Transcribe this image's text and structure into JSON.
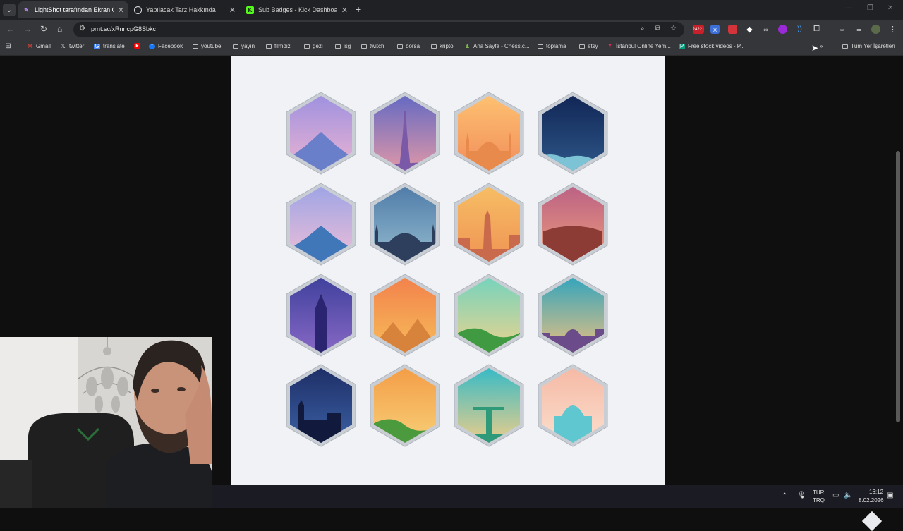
{
  "tabs": [
    {
      "title": "LightShot tarafından Ekran Görüntüsü",
      "favicon": "feather-icon",
      "active": true
    },
    {
      "title": "Yapılacak Tarz Hakkında",
      "favicon": "openai-icon",
      "active": false
    },
    {
      "title": "Sub Badges - Kick Dashboard",
      "favicon": "kick-icon",
      "favicon_text": "K",
      "active": false
    }
  ],
  "toolbar": {
    "url": "prnt.sc/xRnncpG8Sbkc",
    "extension_badge": "24221"
  },
  "bookmarks": [
    {
      "label": "Gmail",
      "icon": "gmail-icon"
    },
    {
      "label": "twitter",
      "icon": "x-icon"
    },
    {
      "label": "translate",
      "icon": "translate-icon"
    },
    {
      "label": "",
      "icon": "youtube-icon"
    },
    {
      "label": "Facebook",
      "icon": "facebook-icon"
    },
    {
      "label": "youtube",
      "icon": "folder-icon"
    },
    {
      "label": "yayın",
      "icon": "folder-icon"
    },
    {
      "label": "filmdizi",
      "icon": "folder-icon"
    },
    {
      "label": "gezi",
      "icon": "folder-icon"
    },
    {
      "label": "isg",
      "icon": "folder-icon"
    },
    {
      "label": "twitch",
      "icon": "folder-icon"
    },
    {
      "label": "borsa",
      "icon": "folder-icon"
    },
    {
      "label": "kripto",
      "icon": "folder-icon"
    },
    {
      "label": "Ana Sayfa - Chess.c...",
      "icon": "chess-icon"
    },
    {
      "label": "toplama",
      "icon": "folder-icon"
    },
    {
      "label": "etsy",
      "icon": "folder-icon"
    },
    {
      "label": "İstanbul Online Yem...",
      "icon": "yemek-icon"
    },
    {
      "label": "Free stock videos - P...",
      "icon": "pexels-icon"
    }
  ],
  "all_bookmarks_label": "Tüm Yer İşaretleri",
  "badges": [
    {
      "name": "mount-fuji-blossom",
      "sky": [
        "#9a8fe0",
        "#f1b6d1"
      ],
      "ground": "#6a7fc9"
    },
    {
      "name": "eiffel-tower",
      "sky": [
        "#5d67c4",
        "#e79aa6"
      ],
      "ground": "#7a5aa8"
    },
    {
      "name": "hagia-sophia",
      "sky": [
        "#ffc472",
        "#f08a5a"
      ],
      "ground": "#e98a4d"
    },
    {
      "name": "night-sky-clouds",
      "sky": [
        "#0f2353",
        "#2f5a8b"
      ],
      "ground": "#7cc3d6"
    },
    {
      "name": "mount-fuji-blossom-2",
      "sky": [
        "#9aa3e6",
        "#f3c0d6"
      ],
      "ground": "#3f77b8"
    },
    {
      "name": "mosque-skyline",
      "sky": [
        "#4c78a6",
        "#98bfd2"
      ],
      "ground": "#2e3f5e"
    },
    {
      "name": "statue-of-liberty",
      "sky": [
        "#f7c065",
        "#ef9153"
      ],
      "ground": "#c86a4b"
    },
    {
      "name": "colosseum",
      "sky": [
        "#b95e86",
        "#f0a07a"
      ],
      "ground": "#8c3b35"
    },
    {
      "name": "big-ben",
      "sky": [
        "#3b3f9a",
        "#8c6ac8"
      ],
      "ground": "#2b2470"
    },
    {
      "name": "pyramids",
      "sky": [
        "#f27e4b",
        "#f7c05a"
      ],
      "ground": "#d8833c"
    },
    {
      "name": "great-wall",
      "sky": [
        "#6fd3bf",
        "#f4d38a"
      ],
      "ground": "#3f9a42"
    },
    {
      "name": "city-dome",
      "sky": [
        "#2aa3c0",
        "#f6c27b"
      ],
      "ground": "#6b4b8a"
    },
    {
      "name": "london-night",
      "sky": [
        "#1c2c63",
        "#3d63a8"
      ],
      "ground": "#11193d"
    },
    {
      "name": "great-wall-2",
      "sky": [
        "#f49a44",
        "#f7d27a"
      ],
      "ground": "#4c9a3e"
    },
    {
      "name": "christ-the-redeemer",
      "sky": [
        "#2cb9c9",
        "#f8cf86"
      ],
      "ground": "#2f9a7a"
    },
    {
      "name": "taj-mahal",
      "sky": [
        "#f5b7a3",
        "#fbe1cf"
      ],
      "ground": "#5ec7d0"
    }
  ],
  "taskbar": {
    "lang_top": "TUR",
    "lang_bottom": "TRQ",
    "time": "16:12",
    "date": "8.02.2026"
  }
}
